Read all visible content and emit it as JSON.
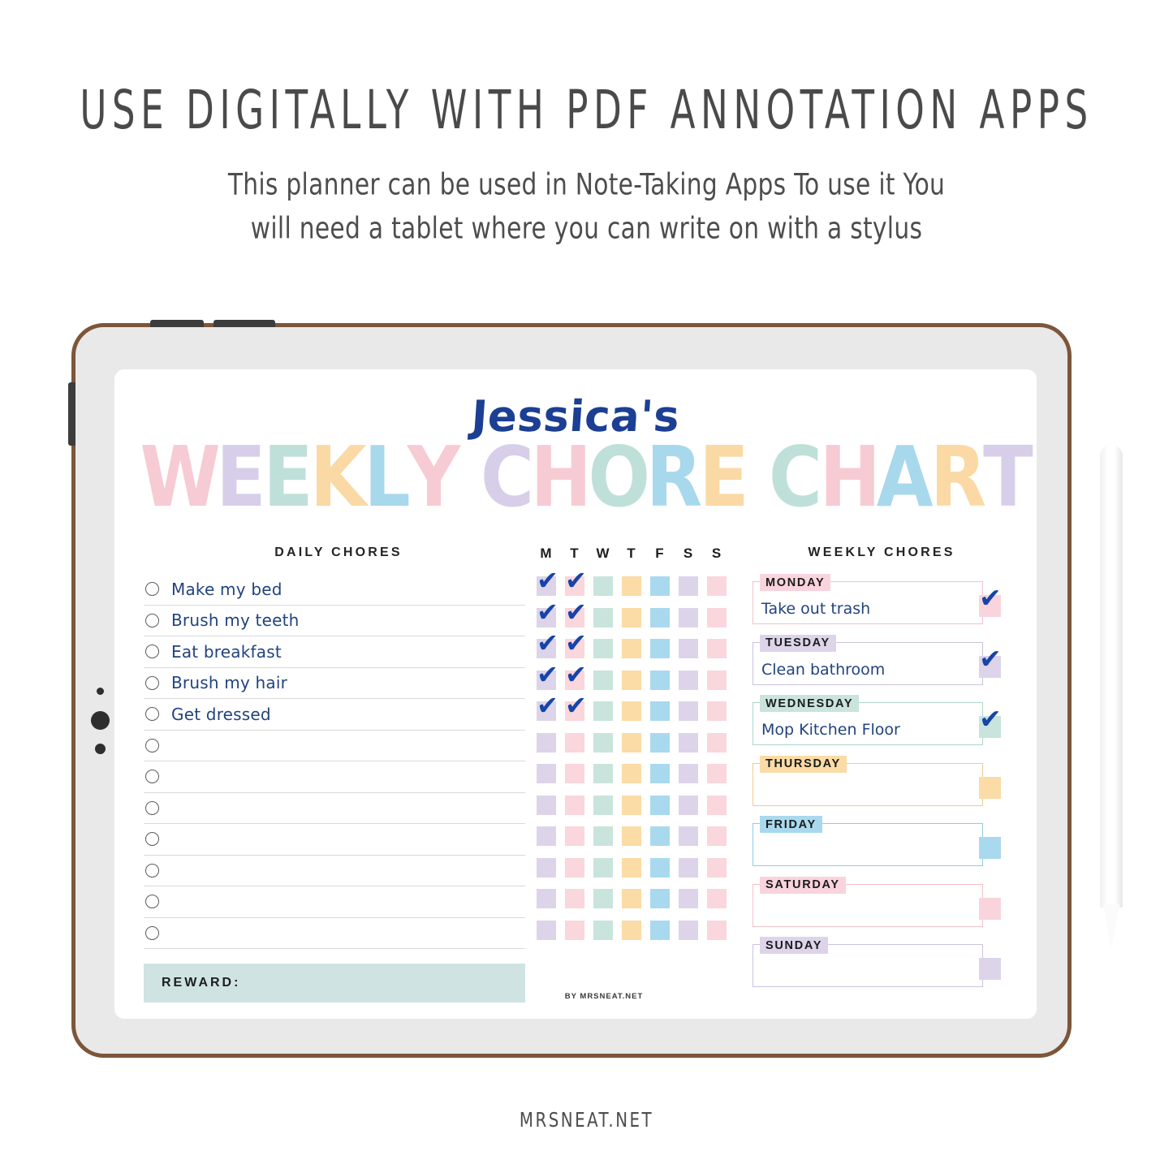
{
  "promo": {
    "headline": "USE DIGITALLY WITH PDF ANNOTATION APPS",
    "subline_1": "This planner can be used in Note-Taking Apps  To use it You",
    "subline_2": "will need a tablet where you can write on with a stylus",
    "brand": "MRSNEAT.NET"
  },
  "planner": {
    "name_title": "Jessica's",
    "big_title": "WEEKLY CHORE CHART",
    "big_title_letters": [
      {
        "ch": "W",
        "color": "#f7cbd3"
      },
      {
        "ch": "E",
        "color": "#d7cfe9"
      },
      {
        "ch": "E",
        "color": "#bfe0d8"
      },
      {
        "ch": "K",
        "color": "#fbd9a4"
      },
      {
        "ch": "L",
        "color": "#a8d8ec"
      },
      {
        "ch": "Y",
        "color": "#f7cbd3"
      },
      {
        "ch": " ",
        "color": "transparent"
      },
      {
        "ch": "C",
        "color": "#d7cfe9"
      },
      {
        "ch": "H",
        "color": "#f7cbd3"
      },
      {
        "ch": "O",
        "color": "#bfe0d8"
      },
      {
        "ch": "R",
        "color": "#a8d8ec"
      },
      {
        "ch": "E",
        "color": "#fbd9a4"
      },
      {
        "ch": " ",
        "color": "transparent"
      },
      {
        "ch": "C",
        "color": "#bfe0d8"
      },
      {
        "ch": "H",
        "color": "#f7cbd3"
      },
      {
        "ch": "A",
        "color": "#a8d8ec"
      },
      {
        "ch": "R",
        "color": "#fbd9a4"
      },
      {
        "ch": "T",
        "color": "#d7cfe9"
      }
    ],
    "daily": {
      "heading": "DAILY CHORES",
      "items": [
        {
          "label": "Make my bed"
        },
        {
          "label": "Brush my teeth"
        },
        {
          "label": "Eat breakfast"
        },
        {
          "label": "Brush my hair"
        },
        {
          "label": "Get dressed"
        },
        {
          "label": ""
        },
        {
          "label": ""
        },
        {
          "label": ""
        },
        {
          "label": ""
        },
        {
          "label": ""
        },
        {
          "label": ""
        },
        {
          "label": ""
        }
      ],
      "reward_label": "REWARD:",
      "reward_value": ""
    },
    "grid": {
      "day_initials": [
        "M",
        "T",
        "W",
        "T",
        "F",
        "S",
        "S"
      ],
      "day_colors": [
        "#ddd4ea",
        "#fad6dd",
        "#c9e4dd",
        "#fbdba6",
        "#a9d9ee",
        "#ddd4ea",
        "#fad6dd"
      ],
      "rows": 12,
      "checked": [
        [
          true,
          true,
          false,
          false,
          false,
          false,
          false
        ],
        [
          true,
          true,
          false,
          false,
          false,
          false,
          false
        ],
        [
          true,
          true,
          false,
          false,
          false,
          false,
          false
        ],
        [
          true,
          true,
          false,
          false,
          false,
          false,
          false
        ],
        [
          true,
          true,
          false,
          false,
          false,
          false,
          false
        ],
        [
          false,
          false,
          false,
          false,
          false,
          false,
          false
        ],
        [
          false,
          false,
          false,
          false,
          false,
          false,
          false
        ],
        [
          false,
          false,
          false,
          false,
          false,
          false,
          false
        ],
        [
          false,
          false,
          false,
          false,
          false,
          false,
          false
        ],
        [
          false,
          false,
          false,
          false,
          false,
          false,
          false
        ],
        [
          false,
          false,
          false,
          false,
          false,
          false,
          false
        ],
        [
          false,
          false,
          false,
          false,
          false,
          false,
          false
        ]
      ]
    },
    "weekly": {
      "heading": "WEEKLY CHORES",
      "items": [
        {
          "day": "MONDAY",
          "task": "Take out trash",
          "color": "#f9d4dc",
          "border": "#f3c0ca",
          "checked": true
        },
        {
          "day": "TUESDAY",
          "task": "Clean bathroom",
          "color": "#ddd4ea",
          "border": "#c9c3dc",
          "checked": true
        },
        {
          "day": "WEDNESDAY",
          "task": "Mop Kitchen Floor",
          "color": "#c9e4dd",
          "border": "#aed6cd",
          "checked": true
        },
        {
          "day": "THURSDAY",
          "task": "",
          "color": "#fbdba6",
          "border": "#f0cb90",
          "checked": false
        },
        {
          "day": "FRIDAY",
          "task": "",
          "color": "#a9d9ee",
          "border": "#8fcbe6",
          "checked": false
        },
        {
          "day": "SATURDAY",
          "task": "",
          "color": "#f9d4dc",
          "border": "#f3c0ca",
          "checked": false
        },
        {
          "day": "SUNDAY",
          "task": "",
          "color": "#ddd4ea",
          "border": "#c9c3dc",
          "checked": false
        }
      ]
    },
    "footer_credit": "BY MRSNEAT.NET"
  },
  "icons": {
    "check": "✔"
  }
}
